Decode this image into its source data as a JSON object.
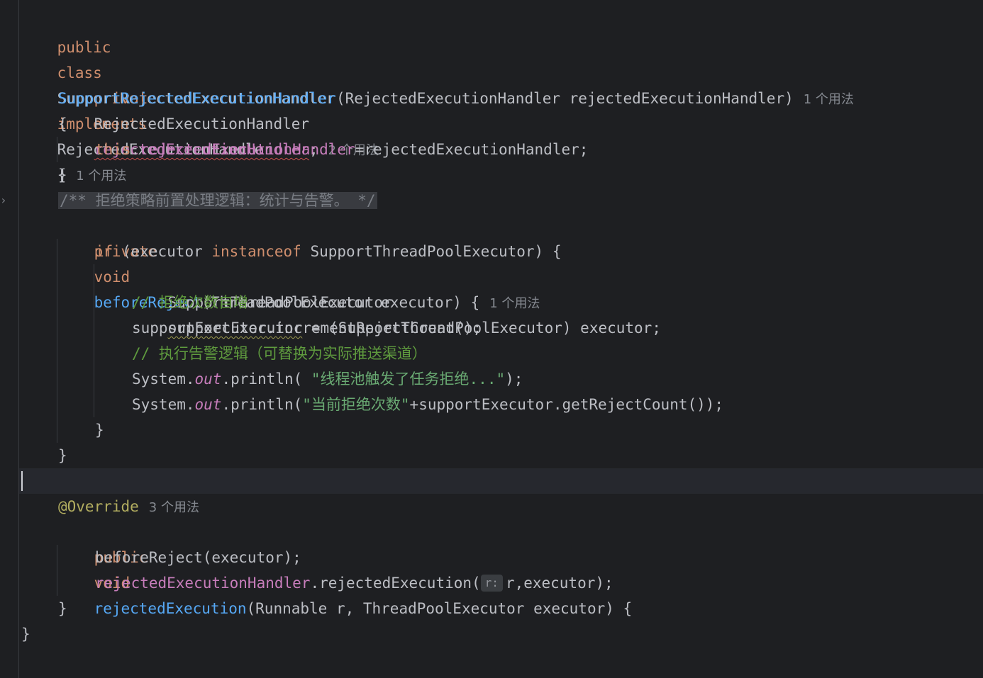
{
  "editor": {
    "language": "Java",
    "colors": {
      "background": "#1e1f22",
      "keyword": "#cf8e6d",
      "method": "#56a8f5",
      "field": "#c77dbb",
      "string": "#6aab73",
      "comment": "#7a7e85",
      "line_comment": "#5f9b3e",
      "annotation": "#b3ae60",
      "text": "#bcbec4"
    },
    "fold_icon": "chevron-right-icon"
  },
  "code": {
    "line1": {
      "kw_public": "public",
      "kw_class": "class",
      "class_name": "SupportRejectedExecutionHandler",
      "kw_implements": "implements",
      "iface": "RejectedExecutionHandler",
      "brace": "{",
      "hint": "1 个用法"
    },
    "line2": {
      "kw_private": "private",
      "type": "RejectedExecutionHandler",
      "field": "rejectedExecutionHandler",
      "semi": ";",
      "hint": "2 个用法"
    },
    "line3": {
      "ctor": "SupportRejectedExecutionHandler",
      "params": "(RejectedExecutionHandler rejectedExecutionHandler)",
      "hint": "1 个用法"
    },
    "line4": {
      "text": "{"
    },
    "line5": {
      "kw_this": "this",
      "dot": ".",
      "field": "rejectedExecutionHandler",
      "rest": "=rejectedExecutionHandler;"
    },
    "line6": {
      "text": "}"
    },
    "line7": {
      "doc_comment": "/** 拒绝策略前置处理逻辑：统计与告警。 */"
    },
    "line8": {
      "kw_private": "private",
      "kw_void": "void",
      "method": "beforeReject",
      "params": "(ThreadPoolExecutor executor) {",
      "hint": "1 个用法"
    },
    "line9": {
      "kw_if": "if",
      "open": " (executor ",
      "kw_instanceof": "instanceof",
      "rest": " SupportThreadPoolExecutor) {"
    },
    "line10": {
      "type": "SupportThreadPoolExecutor",
      "var": "supportExecutor",
      "rest": " = (SupportThreadPoolExecutor) executor;"
    },
    "line11": {
      "comment": "// 拒绝次数自增"
    },
    "line12": {
      "text": "supportExecutor.incrementRejectCount();"
    },
    "line13": {
      "comment": "// 执行告警逻辑（可替换为实际推送渠道）"
    },
    "line14": {
      "sys": "System.",
      "out": "out",
      "call": ".println( ",
      "str": "\"线程池触发了任务拒绝...\"",
      "end": ");"
    },
    "line15": {
      "sys": "System.",
      "out": "out",
      "call": ".println(",
      "str": "\"当前拒绝次数\"",
      "end": "+supportExecutor.getRejectCount());"
    },
    "line16": {
      "text": "}"
    },
    "line17": {
      "text": "}"
    },
    "line19": {
      "annotation": "@Override",
      "hint": "3 个用法"
    },
    "line20": {
      "kw_public": "public",
      "kw_void": "void",
      "method": "rejectedExecution",
      "params": "(Runnable r, ThreadPoolExecutor executor) {"
    },
    "line21": {
      "text": "beforeReject(executor);"
    },
    "line22": {
      "field": "rejectedExecutionHandler",
      "call": ".rejectedExecution(",
      "param_hint": "r:",
      "args": "r,executor);"
    },
    "line23": {
      "text": "}"
    },
    "line24": {
      "text": "}"
    }
  }
}
